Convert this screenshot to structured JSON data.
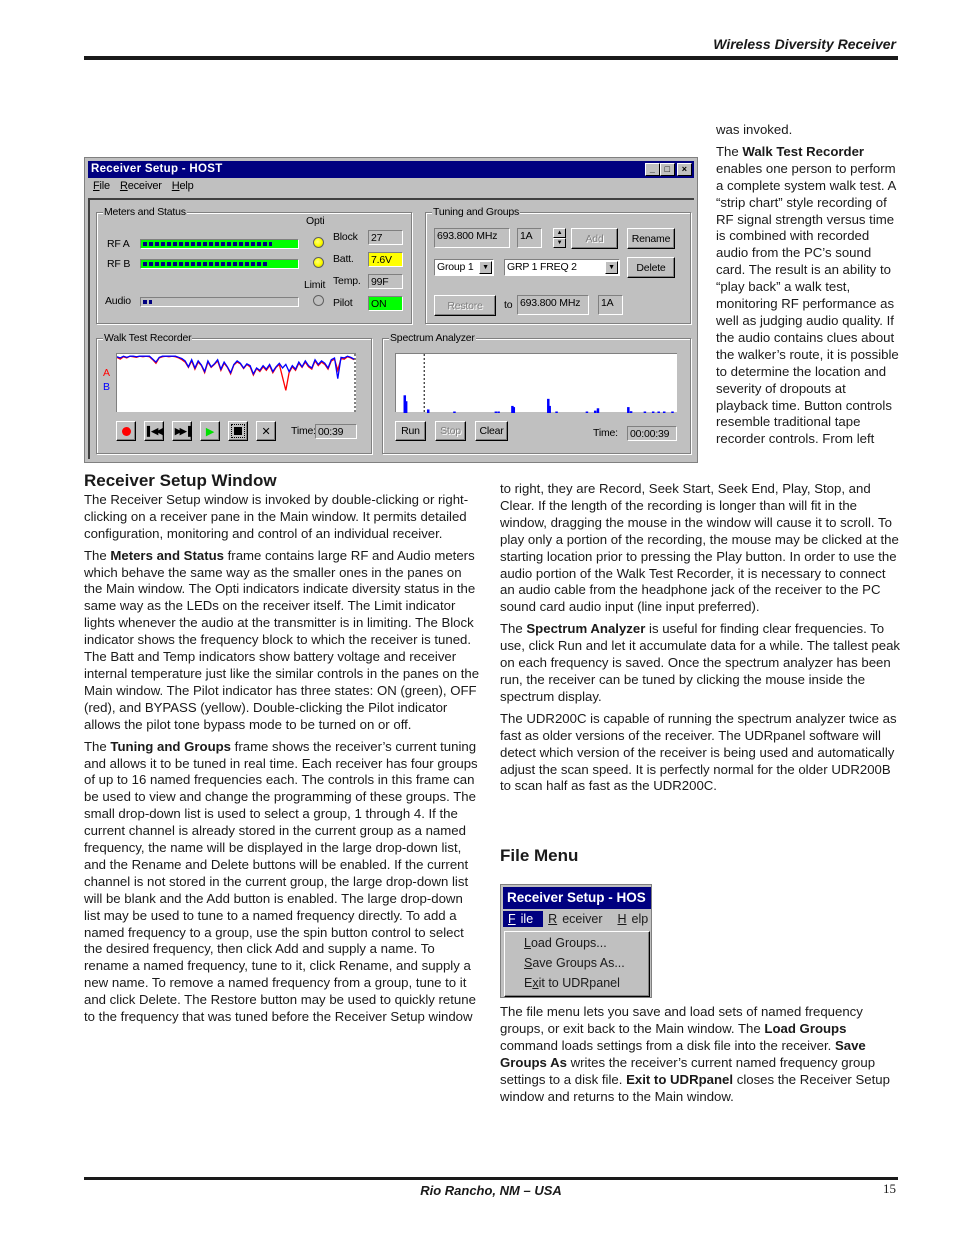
{
  "page": {
    "header_title": "Wireless Diversity Receiver",
    "footer_location": "Rio Rancho, NM – USA",
    "page_number": "15"
  },
  "receiver_window": {
    "title": "Receiver Setup - HOST",
    "title_buttons": {
      "minimize": "_",
      "maximize": "□",
      "close": "×"
    },
    "menu": [
      {
        "accel": "F",
        "rest": "ile"
      },
      {
        "accel": "R",
        "rest": "eceiver"
      },
      {
        "accel": "H",
        "rest": "elp"
      }
    ],
    "meters_status": {
      "frame_label": "Meters and Status",
      "opti_label": "Opti",
      "limit_label": "Limit",
      "rf_a_label": "RF A",
      "rf_b_label": "RF B",
      "audio_label": "Audio",
      "rf_a_level": 0.82,
      "rf_b_level": 0.79,
      "audio_level": 0.06,
      "opti_a": "on",
      "opti_b": "on",
      "limit": "off",
      "block_label": "Block",
      "block_value": "27",
      "batt_label": "Batt.",
      "batt_value": "7.6V",
      "batt_color": "#ffff00",
      "temp_label": "Temp.",
      "temp_value": "99F",
      "pilot_label": "Pilot",
      "pilot_value": "ON",
      "pilot_color": "#00ff00"
    },
    "tuning_groups": {
      "frame_label": "Tuning and Groups",
      "frequency": "693.800 MHz",
      "channel": "1A",
      "add_label": "Add",
      "rename_label": "Rename",
      "group_select": "Group 1",
      "name_select": "GRP 1 FREQ 2",
      "delete_label": "Delete",
      "restore_label": "Restore",
      "to_label": "to",
      "restore_frequency": "693.800 MHz",
      "restore_channel": "1A"
    },
    "walk_test": {
      "frame_label": "Walk Test Recorder",
      "legend_a": "A",
      "legend_b": "B",
      "color_a": "#ff0000",
      "color_b": "#0000ff",
      "buttons": [
        "Record",
        "Seek Start",
        "Seek End",
        "Play",
        "Stop",
        "Clear"
      ],
      "time_label": "Time:",
      "time_value": "00:39",
      "trace_b": [
        0.97,
        0.95,
        0.98,
        0.96,
        0.98,
        0.98,
        0.97,
        0.98,
        0.98,
        0.98,
        0.98,
        0.93,
        0.88,
        0.96,
        0.98,
        0.98,
        0.98,
        0.98,
        0.98,
        0.96,
        0.94,
        0.9,
        0.8,
        0.92,
        0.78,
        0.9,
        0.83,
        0.72,
        0.9,
        0.8,
        0.85,
        0.92,
        0.76,
        0.88,
        0.8,
        0.7,
        0.84,
        0.9,
        0.86,
        0.78,
        0.85,
        0.82,
        0.68,
        0.78,
        0.74,
        0.82,
        0.76,
        0.84,
        0.72,
        0.8,
        0.86,
        0.78,
        0.84,
        0.72,
        0.82,
        0.76,
        0.88,
        0.8,
        0.9,
        0.82,
        0.78,
        0.92,
        0.84,
        0.9,
        0.86,
        0.78,
        0.92,
        0.95,
        0.6,
        0.96,
        0.95,
        0.98,
        0.96,
        0.93
      ],
      "trace_a": [
        0.96,
        0.93,
        0.97,
        0.95,
        0.98,
        0.97,
        0.96,
        0.98,
        0.97,
        0.98,
        0.97,
        0.92,
        0.86,
        0.95,
        0.97,
        0.98,
        0.97,
        0.98,
        0.97,
        0.95,
        0.92,
        0.88,
        0.79,
        0.9,
        0.76,
        0.88,
        0.82,
        0.7,
        0.88,
        0.79,
        0.84,
        0.9,
        0.74,
        0.86,
        0.79,
        0.68,
        0.83,
        0.88,
        0.85,
        0.77,
        0.84,
        0.8,
        0.66,
        0.77,
        0.72,
        0.8,
        0.74,
        0.82,
        0.7,
        0.79,
        0.84,
        0.62,
        0.4,
        0.7,
        0.8,
        0.74,
        0.86,
        0.79,
        0.88,
        0.8,
        0.76,
        0.9,
        0.82,
        0.88,
        0.84,
        0.76,
        0.9,
        0.93,
        0.74,
        0.94,
        0.93,
        0.97,
        0.95,
        0.92
      ]
    },
    "spectrum": {
      "frame_label": "Spectrum Analyzer",
      "run_label": "Run",
      "stop_label": "Stop",
      "clear_label": "Clear",
      "time_label": "Time:",
      "time_value": "00:00:39",
      "marker_position": 0.1,
      "bar_color": "#0000ff",
      "peaks": [
        {
          "pos": 0.02,
          "level": 0.3
        },
        {
          "pos": 0.025,
          "level": 0.2
        },
        {
          "pos": 0.105,
          "level": 0.06
        },
        {
          "pos": 0.2,
          "level": 0.02
        },
        {
          "pos": 0.35,
          "level": 0.02
        },
        {
          "pos": 0.36,
          "level": 0.02
        },
        {
          "pos": 0.41,
          "level": 0.12
        },
        {
          "pos": 0.415,
          "level": 0.1
        },
        {
          "pos": 0.54,
          "level": 0.24
        },
        {
          "pos": 0.545,
          "level": 0.12
        },
        {
          "pos": 0.57,
          "level": 0.02
        },
        {
          "pos": 0.68,
          "level": 0.02
        },
        {
          "pos": 0.71,
          "level": 0.04
        },
        {
          "pos": 0.72,
          "level": 0.08
        },
        {
          "pos": 0.83,
          "level": 0.1
        },
        {
          "pos": 0.84,
          "level": 0.03
        },
        {
          "pos": 0.89,
          "level": 0.01
        },
        {
          "pos": 0.92,
          "level": 0.02
        },
        {
          "pos": 0.94,
          "level": 0.02
        },
        {
          "pos": 0.96,
          "level": 0.01
        },
        {
          "pos": 0.99,
          "level": 0.02
        }
      ]
    }
  },
  "sections": {
    "receiver_setup": {
      "heading": "Receiver Setup Window",
      "p1": "The Receiver Setup window is invoked by double-clicking or right-clicking on a receiver pane in the Main window.  It permits detailed configuration, monitoring and control of an individual receiver.",
      "p2_pre": "The ",
      "p2_bold": "Meters and Status",
      "p2_post": " frame contains large RF and Audio meters which behave the same way as the smaller ones in the panes on the Main window.   The Opti indicators indicate diversity status in the same way as the LEDs on the receiver itself.  The Limit indicator lights whenever the audio at the transmitter is in limiting.  The Block indicator shows the frequency block to which the receiver is tuned.  The Batt and Temp indicators show battery voltage and receiver internal temperature just like the similar controls in the panes on the Main window.  The Pilot indicator has three states: ON (green), OFF (red), and BYPASS (yellow).  Double-clicking the Pilot indicator allows the pilot tone bypass mode to be turned on or off.",
      "p3_pre": "The ",
      "p3_bold": "Tuning and Groups",
      "p3_post": " frame shows the receiver’s current tuning and allows it to be tuned in real time.  Each receiver has four groups of up to 16 named frequencies each.  The controls in this frame can be used to view and change the programming of these groups.  The small drop-down list is used to select a group, 1 through 4.  If the current channel is already stored in the current group as a named frequency, the name will be displayed in the large drop-down list, and the Rename and Delete buttons will be enabled.  If the current channel is not stored in the current group, the large drop-down list will be blank and the Add button is enabled.  The large drop-down list may be used to tune to a named frequency directly.  To add a named frequency to a group, use the spin button control to select the desired frequency, then click Add and supply a name.  To rename a named frequency, tune to it, click Rename, and supply a new name.  To remove a named frequency from a group, tune to it and click Delete.  The Restore button may be used to quickly retune to the frequency that was tuned before the Receiver Setup window"
    },
    "right_column": {
      "continued": "was invoked.",
      "walk_pre": "The ",
      "walk_bold": "Walk Test Recorder",
      "walk_post": " enables one person to perform a complete system walk test.  A “strip chart” style recording of RF signal strength versus time is combined with recorded audio from the PC’s sound card.  The result is an ability to “play back” a walk test, monitoring RF performance as well as judging audio quality.  If the audio contains clues about the walker’s route, it is possible to determine the location and severity of dropouts at playback time.  Button controls resemble traditional tape recorder controls.  From left",
      "walk_cont": "to right, they are Record, Seek Start, Seek End, Play, Stop, and Clear.  If the length of the recording is longer than will fit in the window, dragging the mouse in the window will cause it to scroll.  To play only a portion of the recording, the mouse may be clicked at the starting location prior to pressing the Play button.  In order to use the audio portion of the Walk Test Recorder, it is necessary to connect an audio cable from the headphone jack of the receiver to the PC sound card audio input (line input preferred).",
      "spec_pre": "The ",
      "spec_bold": "Spectrum Analyzer",
      "spec_post": " is useful for finding clear frequencies.  To use, click Run and let it accumulate data for a while.  The tallest peak on each frequency is saved.  Once the spectrum analyzer has been run, the receiver can be tuned by clicking the mouse inside the spectrum display.",
      "udr": "The UDR200C is capable of running the spectrum analyzer twice as fast as older versions of the receiver.  The UDRpanel software will detect which version of the receiver is being used and automatically adjust the scan speed.  It is perfectly normal for the older UDR200B to scan half as fast as the UDR200C."
    },
    "file_menu": {
      "heading": "File Menu",
      "p_pre": "The file menu lets you save and load sets of named frequency groups, or exit back to the Main window.  The ",
      "p_b1": "Load Groups",
      "p_m1": " command loads settings from a disk file into the receiver. ",
      "p_b2": "Save Groups As",
      "p_m2": " writes the receiver’s current named frequency group settings to a disk file.  ",
      "p_b3": "Exit to UDRpanel",
      "p_post": " closes the Receiver Setup window and returns to the Main window."
    }
  },
  "file_menu_screenshot": {
    "title": "Receiver Setup - HOS",
    "menubar": [
      {
        "accel": "F",
        "rest": "ile",
        "active": true
      },
      {
        "accel": "R",
        "rest": "eceiver",
        "active": false
      },
      {
        "accel": "H",
        "rest": "elp",
        "active": false
      }
    ],
    "items": [
      {
        "pre": "",
        "accel": "L",
        "rest": "oad Groups..."
      },
      {
        "pre": "",
        "accel": "S",
        "rest": "ave Groups As..."
      },
      {
        "pre": "E",
        "accel": "x",
        "rest": "it to UDRpanel"
      }
    ]
  }
}
